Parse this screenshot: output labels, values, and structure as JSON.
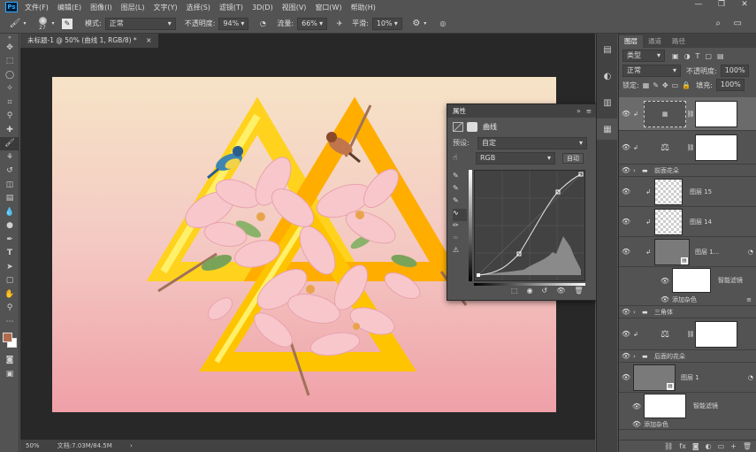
{
  "menu": {
    "logo": "Ps",
    "items": [
      "文件(F)",
      "编辑(E)",
      "图像(I)",
      "图层(L)",
      "文字(Y)",
      "选择(S)",
      "滤镜(T)",
      "3D(D)",
      "视图(V)",
      "窗口(W)",
      "帮助(H)"
    ],
    "window_controls": [
      "—",
      "❐",
      "✕"
    ]
  },
  "options": {
    "brush_size": "27",
    "mode_label": "模式:",
    "mode_value": "正常",
    "opacity_label": "不透明度:",
    "opacity_value": "94%",
    "flow_label": "流量:",
    "flow_value": "66%",
    "smooth_label": "平滑:",
    "smooth_value": "10%"
  },
  "document": {
    "tab_title": "未标题-1 @ 50% (曲线 1, RGB/8) *",
    "close": "×",
    "status_zoom": "50%",
    "status_doc": "文档:7.03M/84.5M",
    "status_arrow": "›"
  },
  "properties": {
    "title": "属性",
    "collapse": "»",
    "menu": "≡",
    "adjustment_name": "曲线",
    "preset_label": "预设:",
    "preset_value": "自定",
    "channel_value": "RGB",
    "auto_button": "自动"
  },
  "layers_panel": {
    "tabs": [
      "图层",
      "通道",
      "路径"
    ],
    "filter_kind": "类型",
    "blend_mode": "正常",
    "opacity_label": "不透明度:",
    "opacity_value": "100%",
    "lock_label": "锁定:",
    "fill_label": "填充:",
    "fill_value": "100%",
    "layers": [
      {
        "name": ""
      },
      {
        "name": ""
      },
      {
        "name": "前面花朵"
      },
      {
        "name": "图层 15"
      },
      {
        "name": "图层 14"
      },
      {
        "name": "图层 1..."
      },
      {
        "name": "智能滤镜"
      },
      {
        "name": "添加杂色"
      },
      {
        "name": "三角体"
      },
      {
        "name": ""
      },
      {
        "name": "后面的花朵"
      },
      {
        "name": "图层 1"
      },
      {
        "name": "智能滤镜"
      },
      {
        "name": "添加杂色"
      }
    ],
    "footer_icons": [
      "⛓",
      "fx",
      "◙",
      "◐",
      "▭",
      "+",
      "🗑"
    ]
  },
  "colors": {
    "accent": "#31a8ff",
    "triangle_yellow": "#ffd21e",
    "triangle_orange": "#ffae00",
    "triangle_light": "#fff06a"
  }
}
